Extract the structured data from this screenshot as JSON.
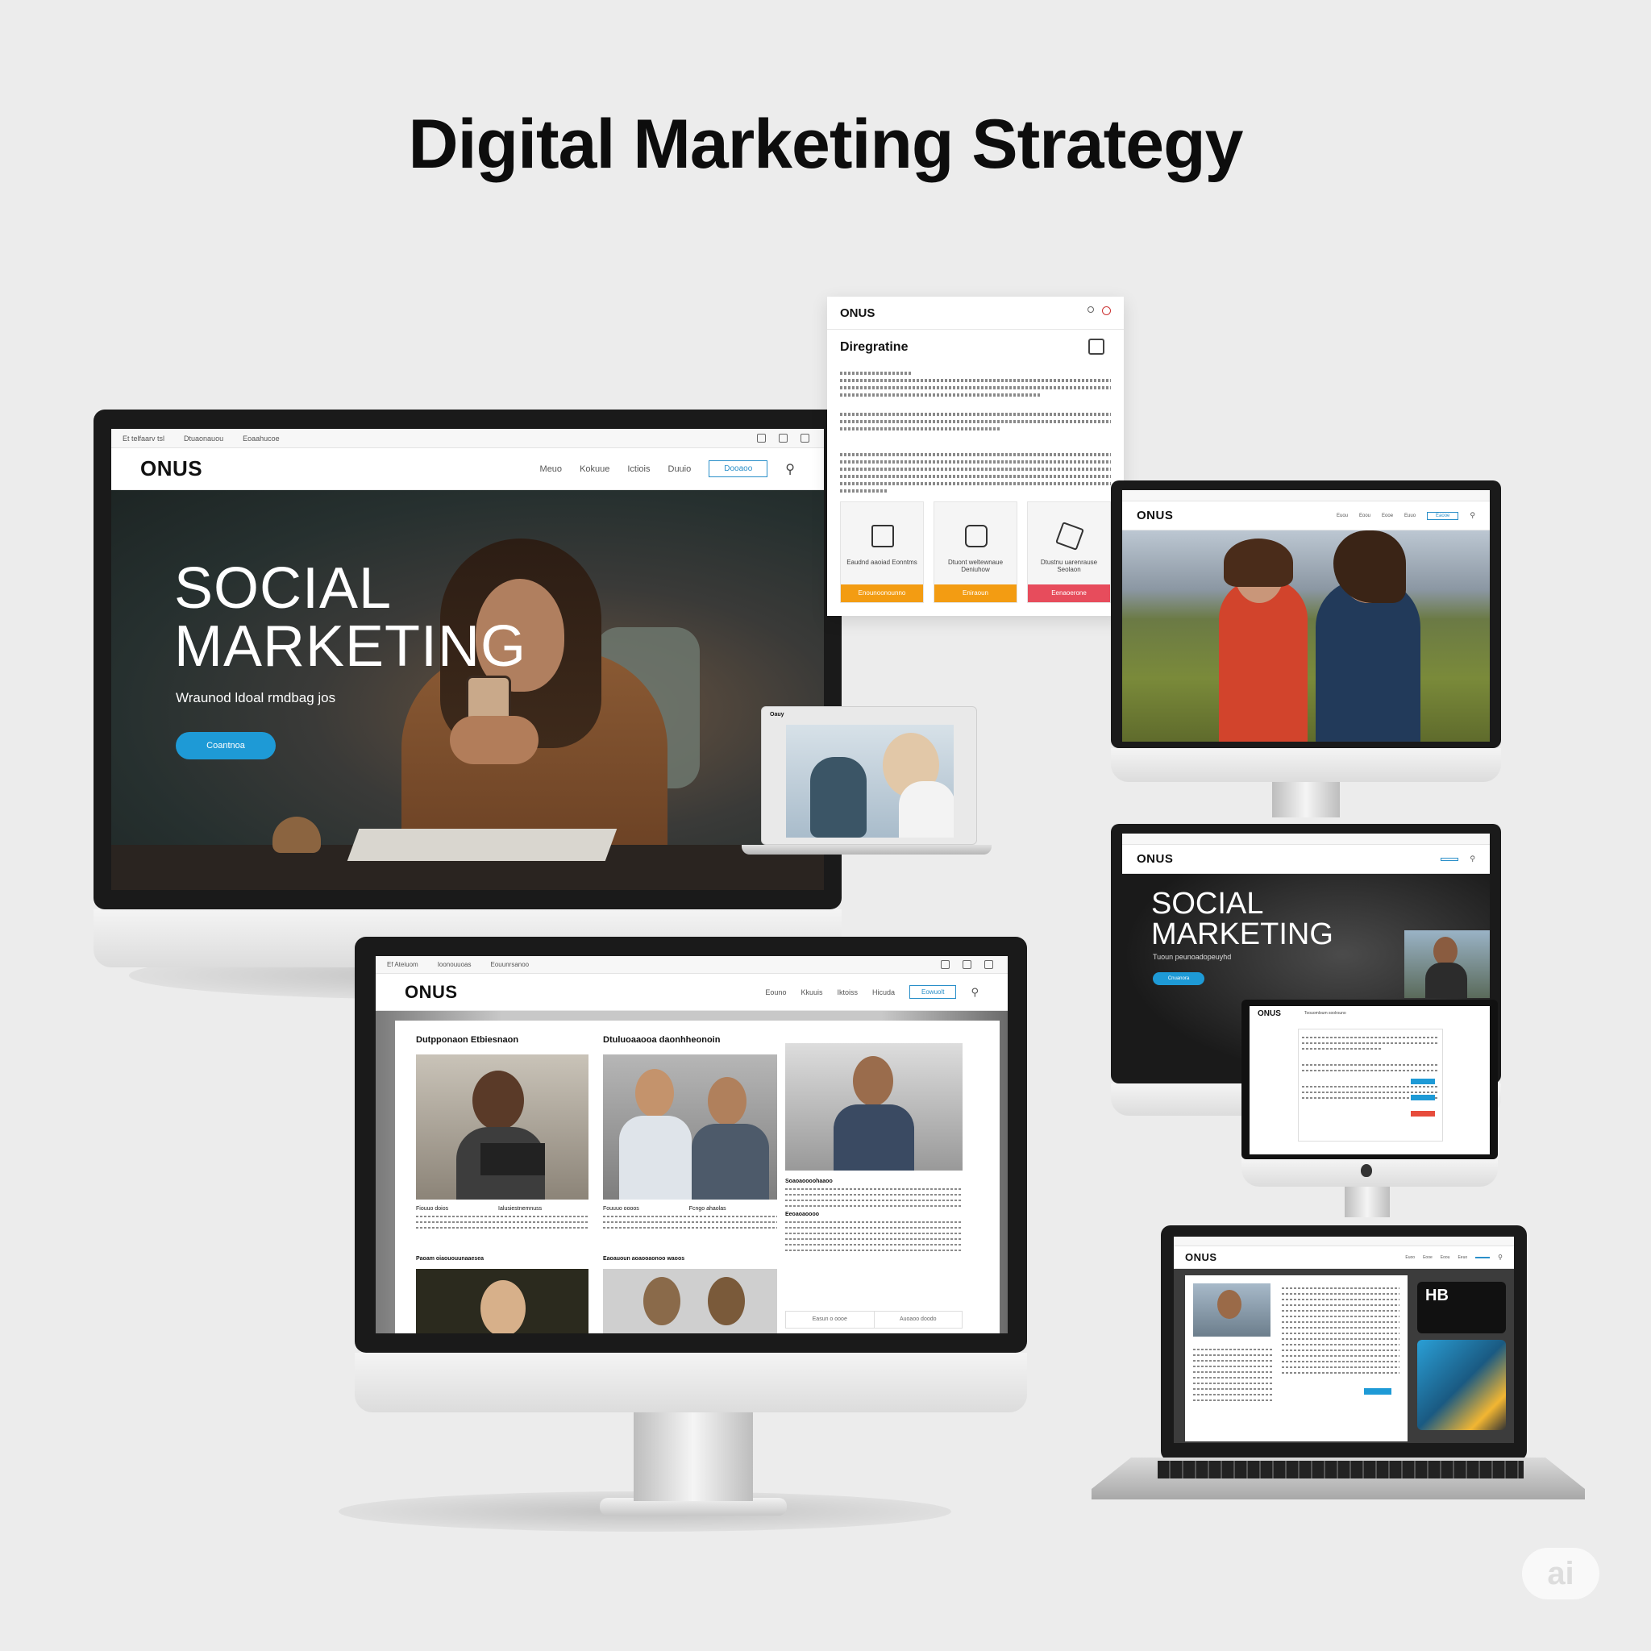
{
  "page_title": "Digital Marketing Strategy",
  "brand": "ONUS",
  "main_monitor": {
    "topbar": [
      "Et telfaarv tsl",
      "Dtuaonauou",
      "Eoaahucoe"
    ],
    "nav": [
      "Meuo",
      "Kokuue",
      "Ictiois",
      "Duuio"
    ],
    "nav_button": "Dooaoo",
    "hero_line1": "SOCIAL",
    "hero_line2": "MARKETING",
    "hero_subtitle": "Wraunod ldoal rmdbag jos",
    "hero_button": "Coantnoa"
  },
  "floating_doc": {
    "heading": "Diregratine",
    "cards": [
      {
        "label": "Eaudnd aaoiad Eonntms",
        "button": "Enounoonounno",
        "color": "#f39c12"
      },
      {
        "label": "Dtuont weltewnaue Deniuhow",
        "button": "Eniraoun",
        "color": "#f39c12"
      },
      {
        "label": "Dtustnu uarenrause Seolaon",
        "button": "Eenaoerone",
        "color": "#e74c5c"
      }
    ]
  },
  "small_laptop": {
    "label": "Oauy"
  },
  "right_monitor_1": {
    "nav": [
      "Euou",
      "Eoou",
      "Eooe",
      "Euuo"
    ],
    "nav_button": "Eaooe"
  },
  "right_monitor_2": {
    "hero_line1": "SOCIAL",
    "hero_line2": "MARKETING",
    "hero_subtitle": "Tuoun peunoadopeuyhd",
    "hero_button": "Cnuanora",
    "inner_header": "Toouomloum soolrsuno"
  },
  "bottom_monitor": {
    "topbar": [
      "Ef Ateiuom",
      "Ioonouuoas",
      "Eouunrsanoo"
    ],
    "nav": [
      "Eouno",
      "Kkuuis",
      "Iktoiss",
      "Hicuda"
    ],
    "nav_button": "Eowuolt",
    "section1": "Dutpponaon Etbiesnaon",
    "section2": "Dtuluoaaooa daonhheonoin",
    "captions": [
      "Fiouuo doios",
      "Ialusiestnemnuss",
      "Fouuuo oooos",
      "Fcngo ahaolas"
    ],
    "row2_1": "Paoam oiaououunaaesea",
    "row2_2": "Eaoauoun aoaooaonoo waoos",
    "side_heading1": "Soaoaoooohaaoo",
    "side_heading2": "Eeoaoaoooo",
    "tab1": "Easun o oooe",
    "tab2": "Auoaoo doodo"
  },
  "laptop": {
    "nav": [
      "Euoo",
      "Eooe",
      "Eoou",
      "Eeuo"
    ],
    "badge": "HB"
  },
  "watermark": "ai"
}
